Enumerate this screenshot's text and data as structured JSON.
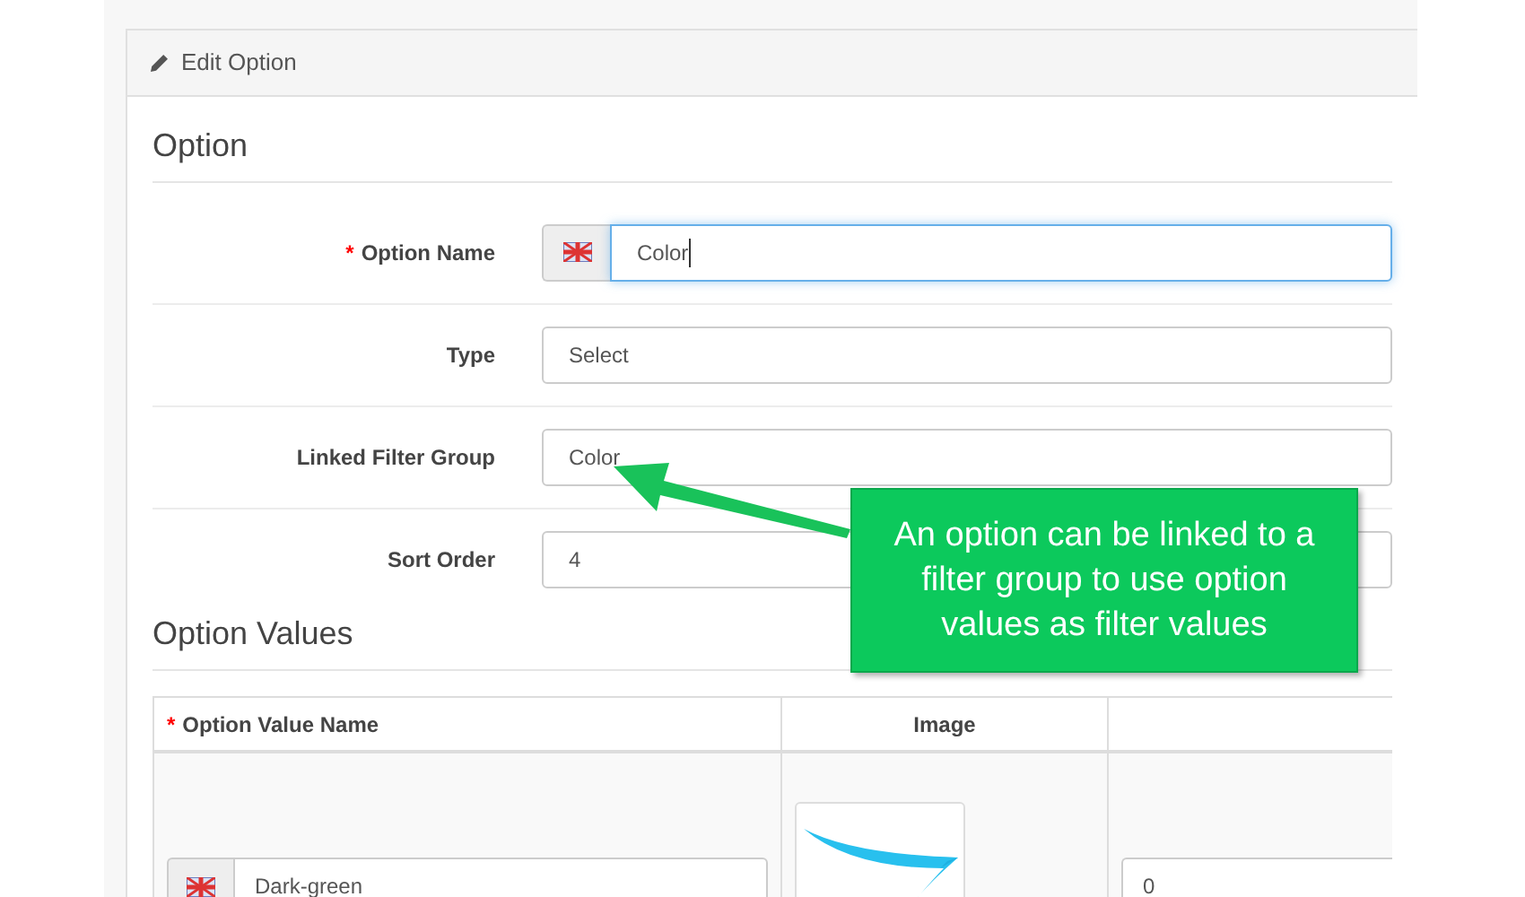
{
  "panel": {
    "title": "Edit Option"
  },
  "option_section": {
    "title": "Option"
  },
  "fields": [
    {
      "label": "Option Name",
      "required_mark": "*",
      "kind": "language",
      "value": "Color",
      "focused": true
    },
    {
      "label": "Type",
      "kind": "plain",
      "value": "Select",
      "focused": false
    },
    {
      "label": "Linked Filter Group",
      "kind": "plain",
      "value": "Color",
      "focused": false
    },
    {
      "label": "Sort Order",
      "kind": "plain",
      "value": "4",
      "focused": false
    }
  ],
  "values_section": {
    "title": "Option Values"
  },
  "table": {
    "columns": [
      {
        "label": "Option Value Name",
        "required_mark": "*"
      },
      {
        "label": "Image"
      }
    ],
    "rows": [
      {
        "name": "Dark-green",
        "column_3": "0"
      }
    ]
  },
  "callout": {
    "text": "An option can be linked to a filter group to use option values as filter values"
  }
}
